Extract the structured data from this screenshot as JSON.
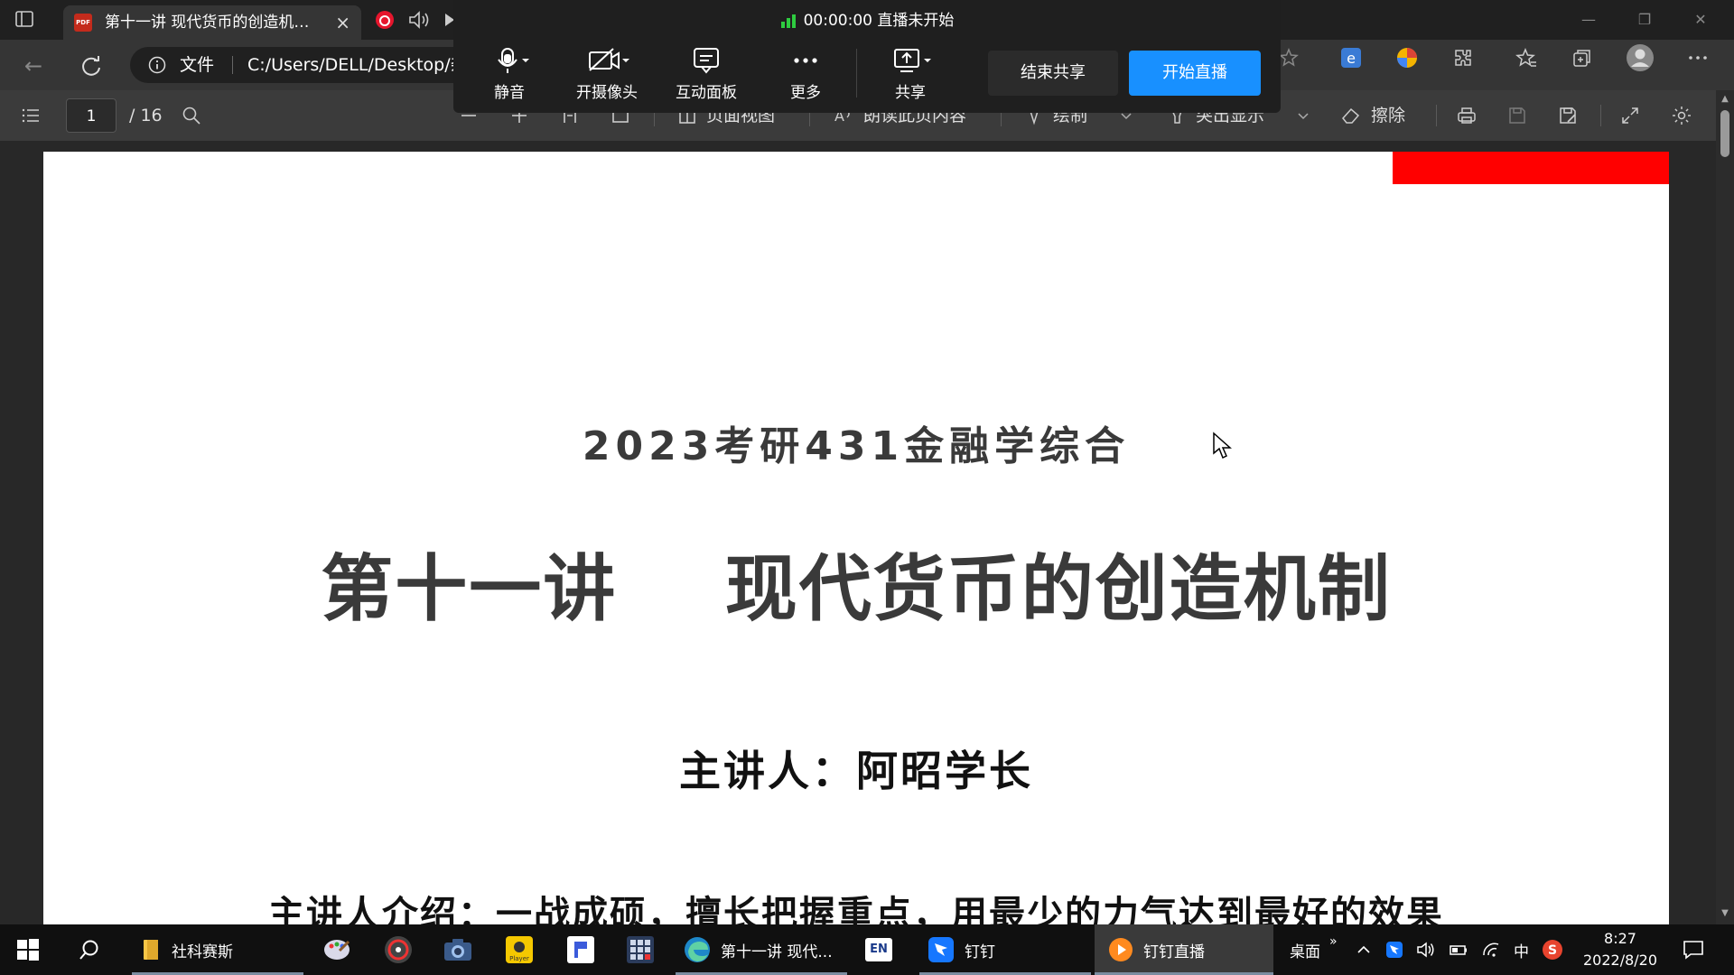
{
  "browser": {
    "tab_title": "第十一讲 现代货币的创造机制.pdf",
    "file_label": "文件",
    "url": "C:/Users/DELL/Desktop/杂"
  },
  "pdf_toolbar": {
    "page_current": "1",
    "page_total": "/ 16",
    "page_view_label": "页面视图",
    "read_aloud_label": "朗读此页内容",
    "draw_label": "绘制",
    "highlight_label": "突出显示",
    "erase_label": "擦除"
  },
  "live_overlay": {
    "status": "00:00:00 直播未开始",
    "mute_label": "静音",
    "camera_label": "开摄像头",
    "panel_label": "互动面板",
    "more_label": "更多",
    "share_label": "共享",
    "end_share_label": "结束共享",
    "start_live_label": "开始直播"
  },
  "document": {
    "subtitle": "2023考研431金融学综合",
    "title": "第十一讲    现代货币的创造机制",
    "speaker": "主讲人：阿昭学长",
    "intro": "主讲人介绍：一战成硕，擅长把握重点，用最少的力气达到最好的效果"
  },
  "taskbar": {
    "folder_label": "社科赛斯",
    "edge_label": "第十一讲 现代...",
    "dingtalk_label": "钉钉",
    "dinglive_label": "钉钉直播",
    "desktop_label": "桌面",
    "ime_lang": "中",
    "en_badge": "EN",
    "time": "8:27",
    "date": "2022/8/20"
  },
  "colors": {
    "accent_blue": "#1890ff",
    "red_banner": "#ff0000",
    "signal_green": "#2ecc40"
  }
}
